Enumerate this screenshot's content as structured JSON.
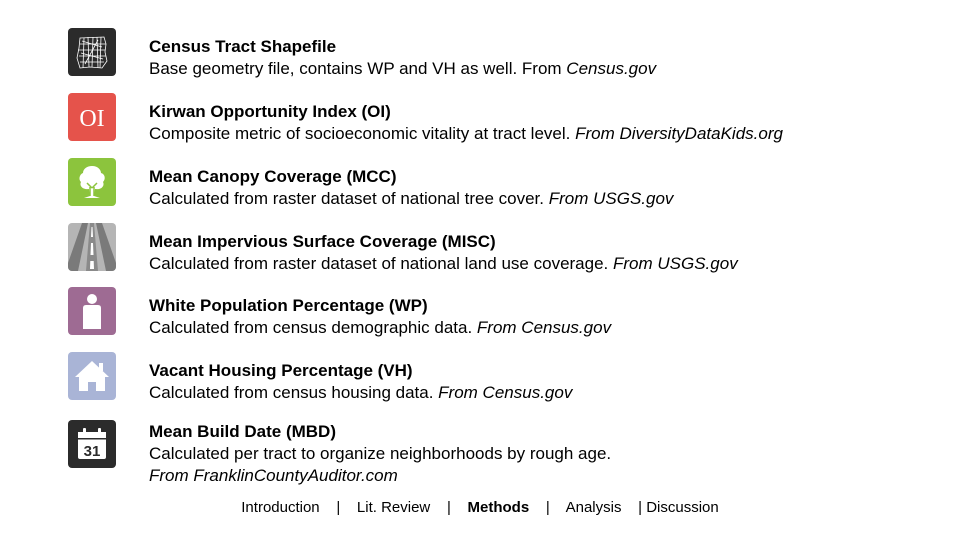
{
  "items": [
    {
      "icon": "census-map-icon",
      "color": "#2b2b2b",
      "title": "Census Tract Shapefile",
      "desc": "Base geometry file, contains WP and VH as well. From ",
      "source": "Census.gov"
    },
    {
      "icon": "oi-icon",
      "color": "#e5534b",
      "icon_text": "OI",
      "title": "Kirwan Opportunity Index (OI)",
      "desc": "Composite metric of socioeconomic vitality at tract level.  ",
      "source": "From DiversityDataKids.org"
    },
    {
      "icon": "tree-icon",
      "color": "#8cc43d",
      "title": "Mean Canopy Coverage (MCC)",
      "desc": "Calculated from raster dataset of national tree cover.  ",
      "source": "From USGS.gov"
    },
    {
      "icon": "road-icon",
      "color": "#9e9e9e",
      "title": "Mean Impervious Surface Coverage (MISC)",
      "desc": "Calculated from raster dataset of national land use coverage.  ",
      "source": "From USGS.gov"
    },
    {
      "icon": "person-icon",
      "color": "#9e6b93",
      "title": "White Population Percentage (WP)",
      "desc": "Calculated from census demographic data.  ",
      "source": "From Census.gov"
    },
    {
      "icon": "house-icon",
      "color": "#a9b4d6",
      "title": "Vacant Housing Percentage (VH)",
      "desc": "Calculated from census housing data.  ",
      "source": "From Census.gov"
    },
    {
      "icon": "calendar-icon",
      "color": "#2b2b2b",
      "icon_text": "31",
      "title": "Mean Build Date (MBD)",
      "desc": "Calculated per tract to organize neighborhoods by rough age.",
      "source": "From FranklinCountyAuditor.com"
    }
  ],
  "nav": {
    "introduction": "Introduction",
    "sep": "|",
    "lit_review": "Lit. Review",
    "methods": "Methods",
    "analysis": "Analysis",
    "discussion": "| Discussion"
  }
}
